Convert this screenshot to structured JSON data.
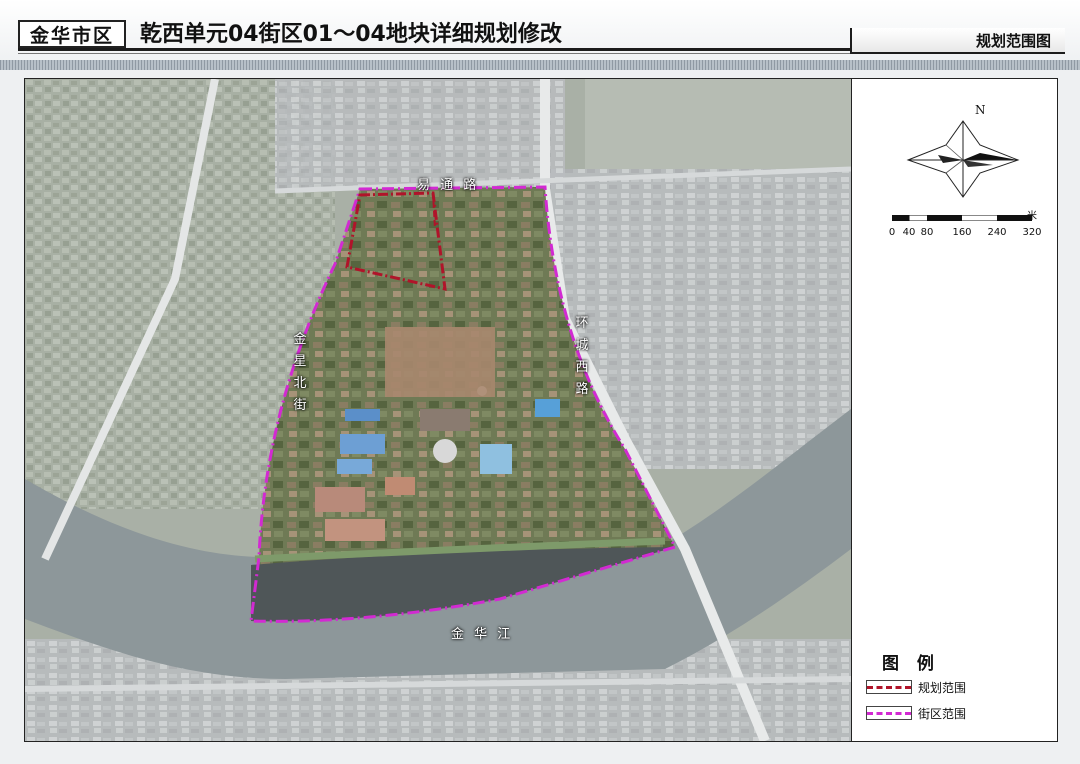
{
  "header": {
    "logo_text": "金华市区",
    "title": "乾西单元04街区01～04地块详细规划修改",
    "sheet_name": "规划范围图"
  },
  "map": {
    "road_labels": {
      "yitong": "易 通 路",
      "huancheng_west": "环城西路",
      "jinxing_north": "金星北街",
      "jinhua_river": "金 华 江"
    }
  },
  "panel": {
    "north": "N",
    "scale_unit": "米",
    "scale_ticks": [
      "0",
      "40",
      "80",
      "160",
      "240",
      "320"
    ]
  },
  "legend": {
    "title": "图 例",
    "items": [
      {
        "label": "规划范围",
        "color": "#b0142a"
      },
      {
        "label": "街区范围",
        "color": "#d22ad2"
      }
    ]
  }
}
